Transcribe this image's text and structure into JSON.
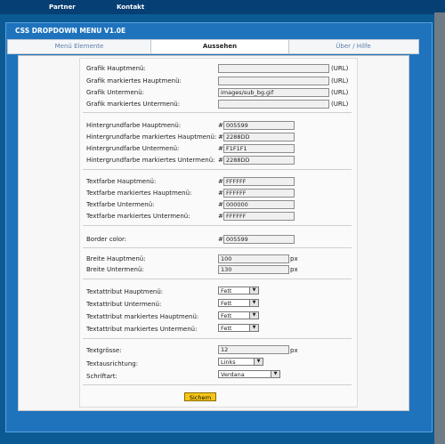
{
  "nav": {
    "partner": "Partner",
    "kontakt": "Kontakt"
  },
  "panel": {
    "title": "CSS DROPDOWN MENU V1.0E"
  },
  "tabs": [
    "Menü Elemente",
    "Aussehen",
    "Über / Hilfe"
  ],
  "labels": {
    "grafik_haupt": "Grafik Hauptmenü:",
    "grafik_markiert_haupt": "Grafik markiertes Hauptmenü:",
    "grafik_unter": "Grafik Untermenü:",
    "grafik_markiert_unter": "Grafik markiertes Untermenü:",
    "bg_haupt": "Hintergrundfarbe Hauptmenü:",
    "bg_markiert_haupt": "Hintergrundfarbe markiertes Hauptmenü:",
    "bg_unter": "Hintergrundfarbe Untermenü:",
    "bg_markiert_unter": "Hintergrundfarbe markiertes Untermenü:",
    "tf_haupt": "Textfarbe Hauptmenü:",
    "tf_markiert_haupt": "Textfarbe markiertes Hauptmenü:",
    "tf_unter": "Textfarbe Untermenü:",
    "tf_markiert_unter": "Textfarbe markiertes Untermenü:",
    "border": "Border color:",
    "breite_haupt": "Breite Hauptmenü:",
    "breite_unter": "Breite Untermenü:",
    "ta_haupt": "Textattribut Hauptmenü:",
    "ta_unter": "Textattribut Untermenü:",
    "ta_markiert_haupt": "Textattribut markiertes Hauptmenü:",
    "ta_markiert_unter": "Textattribut markiertes Untermenü:",
    "textgroesse": "Textgrösse:",
    "ausrichtung": "Textausrichtung:",
    "schriftart": "Schriftart:"
  },
  "units": {
    "url": "(URL)",
    "hash": "#",
    "px": "px"
  },
  "values": {
    "grafik_haupt": "",
    "grafik_markiert_haupt": "",
    "grafik_unter": "images/sub_bg.gif",
    "grafik_markiert_unter": "",
    "bg_haupt": "005599",
    "bg_markiert_haupt": "2288DD",
    "bg_unter": "F1F1F1",
    "bg_markiert_unter": "2288DD",
    "tf_haupt": "FFFFFF",
    "tf_markiert_haupt": "FFFFFF",
    "tf_unter": "000000",
    "tf_markiert_unter": "FFFFFF",
    "border": "005599",
    "breite_haupt": "100",
    "breite_unter": "130",
    "ta_haupt": "Fett",
    "ta_unter": "Fett",
    "ta_markiert_haupt": "Fett",
    "ta_markiert_unter": "Fett",
    "textgroesse": "12",
    "ausrichtung": "Links",
    "schriftart": "Verdana"
  },
  "save_label": "Sichern",
  "colors": {
    "page_bg": "#0b5a93",
    "panel_bg": "#1f73bd",
    "topbar_bg": "#063f73",
    "save_button": "#f5c518"
  }
}
